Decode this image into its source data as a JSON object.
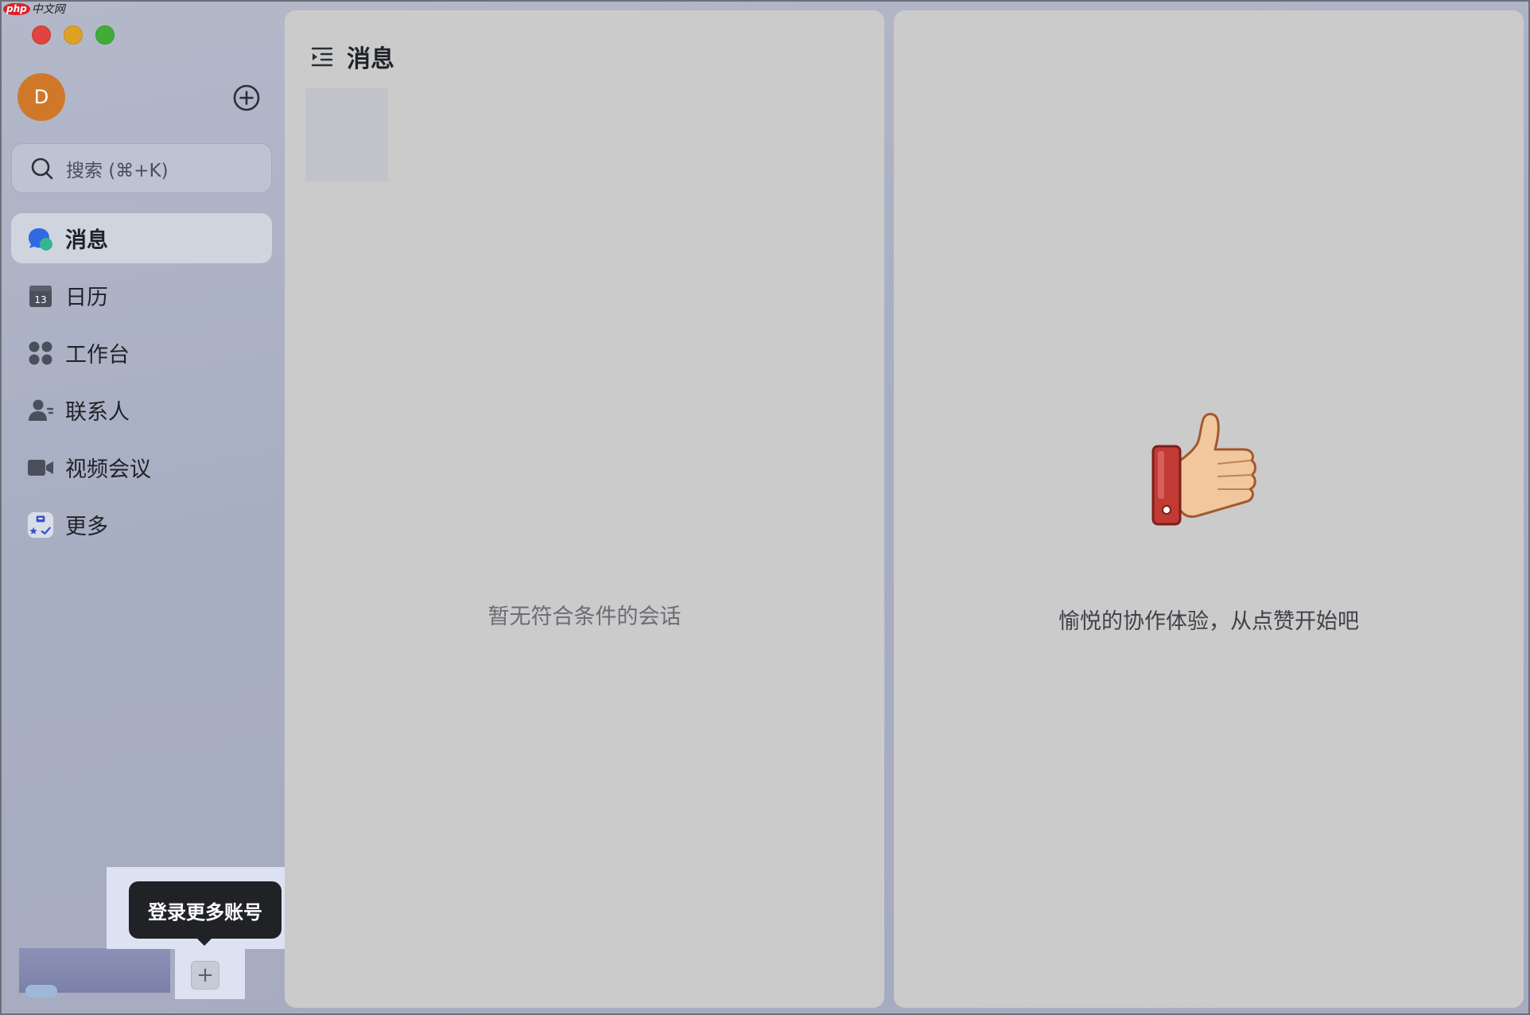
{
  "watermark": {
    "logo": "php",
    "text": "中文网"
  },
  "sidebar": {
    "avatar_initial": "D",
    "search_placeholder": "搜索 (⌘+K)",
    "items": [
      {
        "label": "消息",
        "icon": "chat-bubbles-icon",
        "active": true
      },
      {
        "label": "日历",
        "icon": "calendar-icon",
        "calendar_day": "13"
      },
      {
        "label": "工作台",
        "icon": "apps-grid-icon"
      },
      {
        "label": "联系人",
        "icon": "contacts-icon"
      },
      {
        "label": "视频会议",
        "icon": "video-camera-icon"
      },
      {
        "label": "更多",
        "icon": "more-apps-icon"
      }
    ],
    "tooltip": "登录更多账号",
    "plus_label": "+"
  },
  "messages_panel": {
    "title": "消息",
    "empty_text": "暂无符合条件的会话"
  },
  "detail_panel": {
    "text": "愉悦的协作体验，从点赞开始吧"
  },
  "colors": {
    "accent_blue": "#3370ff",
    "avatar": "#d0782a",
    "tooltip_bg": "#202226"
  }
}
